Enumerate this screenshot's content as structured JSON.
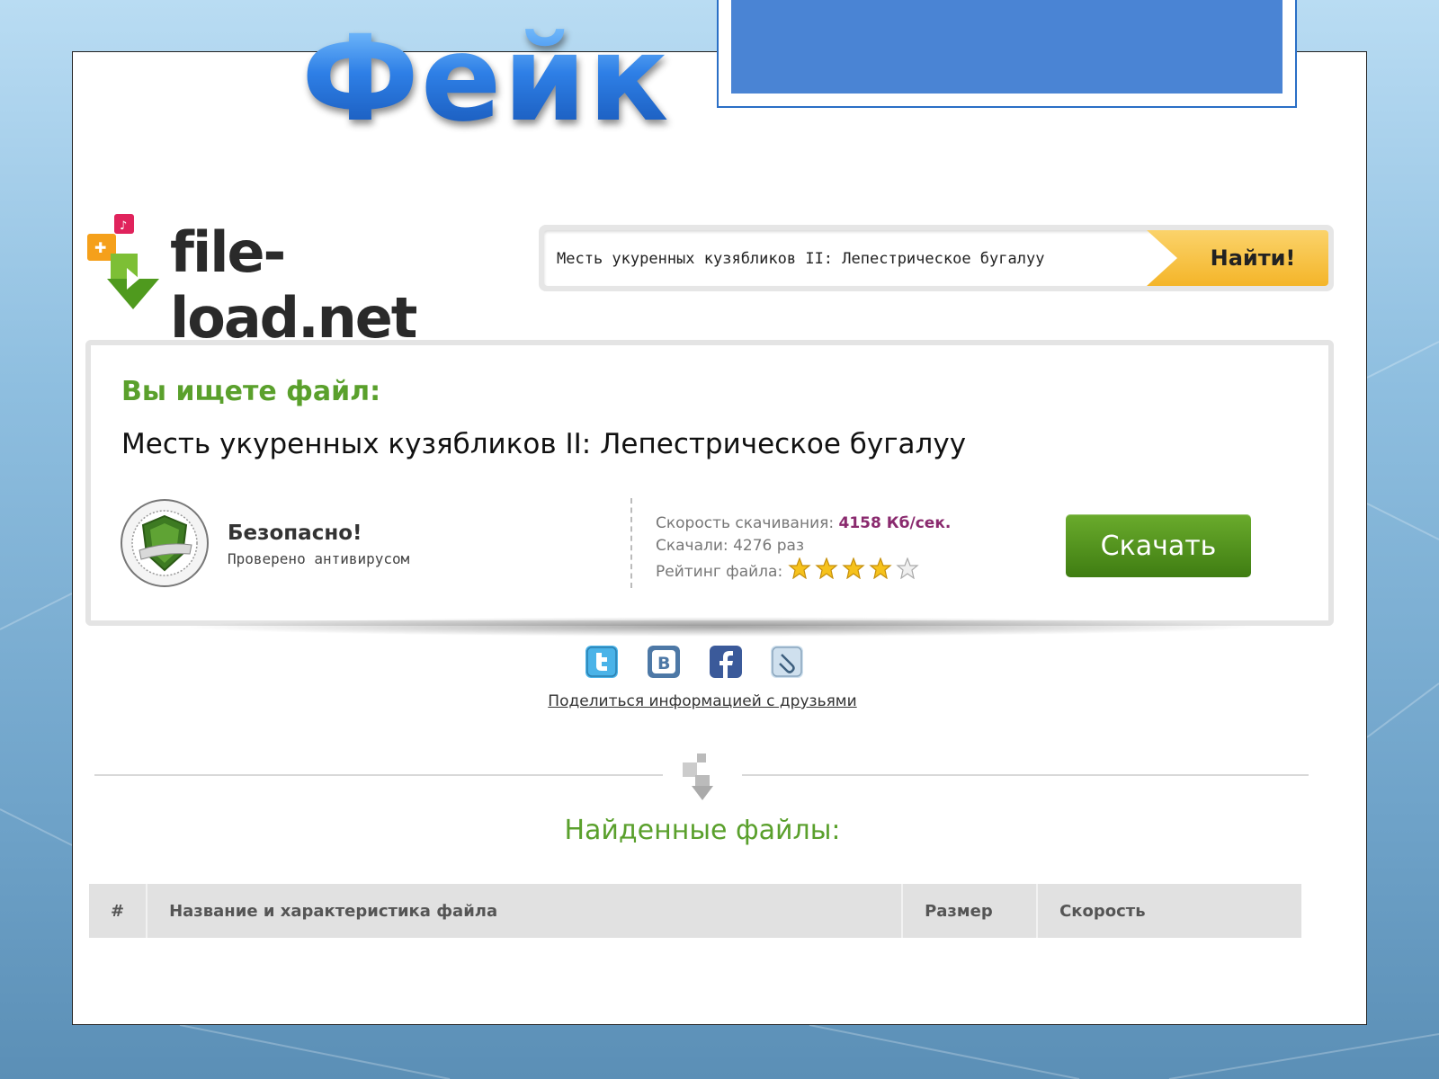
{
  "slide": {
    "title": "Фейк"
  },
  "site": {
    "logo_text": "file-load.net"
  },
  "search": {
    "value": "Месть укуренных кузябликов II: Лепестрическое бугалуу",
    "button_label": "Найти!"
  },
  "panel": {
    "looking_label": "Вы ищете файл:",
    "file_name": "Месть укуренных кузябликов II: Лепестрическое бугалуу",
    "safe_title": "Безопасно!",
    "safe_subtitle": "Проверено антивирусом",
    "speed_label": "Скорость скачивания:",
    "speed_value": "4158 Кб/сек.",
    "downloads_text": "Скачали: 4276 раз",
    "rating_label": "Рейтинг файла:",
    "rating_stars": 4,
    "rating_max": 5,
    "download_label": "Скачать"
  },
  "share": {
    "icons": [
      "twitter-icon",
      "vkontakte-icon",
      "facebook-icon",
      "link-icon"
    ],
    "link_text": "Поделиться информацией с друзьями"
  },
  "results": {
    "title": "Найденные файлы:",
    "columns": [
      "#",
      "Название и характеристика файла",
      "Размер",
      "Скорость"
    ]
  },
  "colors": {
    "accent_green": "#5aa02c",
    "download_green": "#4a8c1c",
    "search_orange": "#f4b529",
    "speed_purple": "#8a2a6e",
    "title_blue": "#2f7be0"
  }
}
